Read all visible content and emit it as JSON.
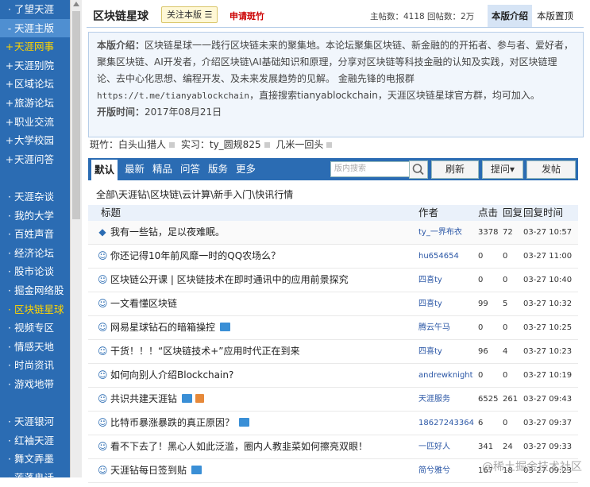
{
  "sidebar": {
    "items": [
      {
        "prefix": "·",
        "label": "了望天涯",
        "style": "normal"
      },
      {
        "prefix": "-",
        "label": "天涯主版",
        "style": "normal"
      },
      {
        "prefix": "+",
        "label": "天涯网事",
        "style": "yellow"
      },
      {
        "prefix": "+",
        "label": "天涯别院",
        "style": "normal"
      },
      {
        "prefix": "+",
        "label": "区域论坛",
        "style": "normal"
      },
      {
        "prefix": "+",
        "label": "旅游论坛",
        "style": "normal"
      },
      {
        "prefix": "+",
        "label": "职业交流",
        "style": "normal"
      },
      {
        "prefix": "+",
        "label": "大学校园",
        "style": "normal"
      },
      {
        "prefix": "+",
        "label": "天涯问答",
        "style": "normal"
      },
      {
        "prefix": "",
        "label": "",
        "style": "normal"
      },
      {
        "prefix": "·",
        "label": "天涯杂谈",
        "style": "normal"
      },
      {
        "prefix": "·",
        "label": "我的大学",
        "style": "normal"
      },
      {
        "prefix": "·",
        "label": "百姓声音",
        "style": "normal"
      },
      {
        "prefix": "·",
        "label": "经济论坛",
        "style": "normal"
      },
      {
        "prefix": "·",
        "label": "股市论谈",
        "style": "normal"
      },
      {
        "prefix": "·",
        "label": "掘金网络股",
        "style": "normal"
      },
      {
        "prefix": "·",
        "label": "区块链星球",
        "style": "yellow"
      },
      {
        "prefix": "·",
        "label": "视频专区",
        "style": "normal"
      },
      {
        "prefix": "·",
        "label": "情感天地",
        "style": "normal"
      },
      {
        "prefix": "·",
        "label": "时尚资讯",
        "style": "normal"
      },
      {
        "prefix": "·",
        "label": "游戏地带",
        "style": "normal"
      },
      {
        "prefix": "",
        "label": "",
        "style": "normal"
      },
      {
        "prefix": "·",
        "label": "天涯银河",
        "style": "normal"
      },
      {
        "prefix": "·",
        "label": "红袖天涯",
        "style": "normal"
      },
      {
        "prefix": "·",
        "label": "舞文弄墨",
        "style": "normal"
      },
      {
        "prefix": "·",
        "label": "莲蓬鬼话",
        "style": "normal"
      }
    ]
  },
  "header": {
    "board_name": "区块链星球",
    "follow_label": "关注本版 ☰",
    "apply_label": "申请斑竹",
    "stats": "主帖数：4118 回帖数：2万",
    "tab_intro": "本版介绍",
    "tab_top": "本版置顶"
  },
  "intro": {
    "label": "本版介绍：",
    "text1": "区块链星球一一践行区块链未来的聚集地。本论坛聚集区块链、新金融的的开拓者、参与者、爱好者，聚集区块链、AI开发者，介绍区块链\\AI基础知识和原理，分享对区块链等科技金融的认知及实践，对区块链理论、去中心化思想、编程开发、及未来发展趋势的见解。 金融先锋的电报群",
    "url": "https://t.me/tianyablockchain",
    "text2": "，直接搜索tianyablockchain，天涯区块链星球官方群，均可加入。",
    "time_label": "开版时间：",
    "time_value": "2017年08月21日"
  },
  "moderators": {
    "label1": "斑竹：",
    "mod1": "白头山猎人",
    "label2": "实习：",
    "mod2": "ty_圆规825",
    "mod3": "几米一回头"
  },
  "tabs": {
    "items": [
      "默认",
      "最新",
      "精品",
      "问答",
      "版务",
      "更多"
    ],
    "search_placeholder": "版内搜索",
    "refresh": "刷新",
    "ask": "提问▾",
    "post": "发帖"
  },
  "category_path": "全部\\天涯钻\\区块链\\云计算\\新手入门\\快讯行情",
  "table": {
    "headers": {
      "title": "标题",
      "author": "作者",
      "clicks": "点击",
      "replies": "回复",
      "time": "回复时间"
    },
    "rows": [
      {
        "icon": "◆",
        "title": "我有一些钻，足以夜难眠。",
        "author": "ty_一界布衣",
        "clicks": "3378",
        "replies": "72",
        "time": "03-27 10:57",
        "img": false,
        "gift": false
      },
      {
        "icon": "☺",
        "title": "你还记得10年前风靡一时的QQ农场么？",
        "author": "hu654654",
        "clicks": "0",
        "replies": "0",
        "time": "03-27 11:00",
        "img": false,
        "gift": false
      },
      {
        "icon": "☺",
        "title": "区块链公开课 | 区块链技术在即时通讯中的应用前景探究",
        "author": "四喜ty",
        "clicks": "0",
        "replies": "0",
        "time": "03-27 10:40",
        "img": false,
        "gift": false
      },
      {
        "icon": "☺",
        "title": "一文看懂区块链",
        "author": "四喜ty",
        "clicks": "99",
        "replies": "5",
        "time": "03-27 10:32",
        "img": false,
        "gift": false
      },
      {
        "icon": "☺",
        "title": "网易星球钻石的暗箱操控",
        "author": "腾云午马",
        "clicks": "0",
        "replies": "0",
        "time": "03-27 10:25",
        "img": true,
        "gift": false
      },
      {
        "icon": "☺",
        "title": "干货！！！“区块链技术+”应用时代正在到来",
        "author": "四喜ty",
        "clicks": "96",
        "replies": "4",
        "time": "03-27 10:23",
        "img": false,
        "gift": false
      },
      {
        "icon": "☺",
        "title": "如何向别人介绍Blockchain?",
        "author": "andrewknight",
        "clicks": "0",
        "replies": "0",
        "time": "03-27 10:19",
        "img": false,
        "gift": false
      },
      {
        "icon": "☺",
        "title": "共识共建天涯钻",
        "author": "天涯服务",
        "clicks": "6525",
        "replies": "261",
        "time": "03-27 09:43",
        "img": true,
        "gift": true
      },
      {
        "icon": "☺",
        "title": "比特币暴涨暴跌的真正原因？",
        "author": "18627243364",
        "clicks": "6",
        "replies": "0",
        "time": "03-27 09:37",
        "img": true,
        "gift": false
      },
      {
        "icon": "☺",
        "title": "看不下去了！黑心人如此泛滥，圈内人教韭菜如何擦亮双眼！",
        "author": "一匹好人",
        "clicks": "341",
        "replies": "24",
        "time": "03-27 09:33",
        "img": false,
        "gift": false
      },
      {
        "icon": "☺",
        "title": "天涯钻每日签到贴",
        "author": "简兮雅兮",
        "clicks": "167",
        "replies": "18",
        "time": "03-27 09:23",
        "img": true,
        "gift": false
      }
    ]
  },
  "watermark": "@稀土掘金技术社区",
  "colors": {
    "sidebar": "#2b6cb3",
    "accent": "#c00",
    "highlight": "#ffd400"
  }
}
